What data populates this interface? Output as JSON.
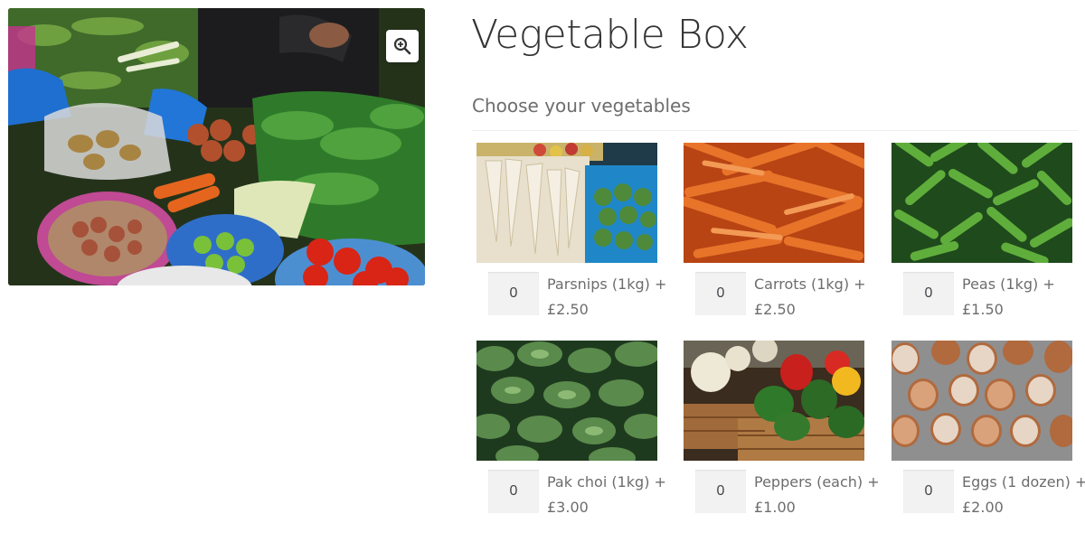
{
  "product": {
    "title": "Vegetable Box",
    "choose_label": "Choose your vegetables"
  },
  "gallery": {
    "zoom_icon": "zoom-in-icon"
  },
  "items": [
    {
      "name": "Parsnips (1kg) +",
      "price": "£2.50",
      "qty": "0"
    },
    {
      "name": "Carrots (1kg) +",
      "price": "£2.50",
      "qty": "0"
    },
    {
      "name": "Peas (1kg) +",
      "price": "£1.50",
      "qty": "0"
    },
    {
      "name": "Pak choi (1kg) +",
      "price": "£3.00",
      "qty": "0"
    },
    {
      "name": "Peppers (each) +",
      "price": "£1.00",
      "qty": "0"
    },
    {
      "name": "Eggs (1 dozen) +",
      "price": "£2.00",
      "qty": "0"
    }
  ]
}
